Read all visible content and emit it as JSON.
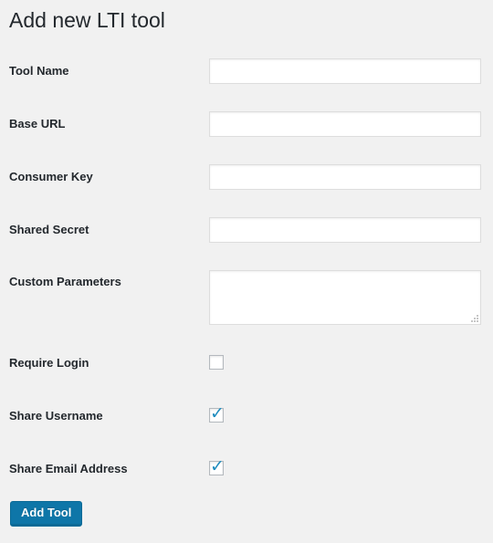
{
  "page": {
    "title": "Add new LTI tool",
    "background_color": "#f1f1f1",
    "text_color": "#23282d"
  },
  "form": {
    "fields": [
      {
        "label": "Tool Name",
        "type": "text",
        "value": "",
        "placeholder": ""
      },
      {
        "label": "Base URL",
        "type": "text",
        "value": "",
        "placeholder": ""
      },
      {
        "label": "Consumer Key",
        "type": "text",
        "value": "",
        "placeholder": ""
      },
      {
        "label": "Shared Secret",
        "type": "text",
        "value": "",
        "placeholder": ""
      },
      {
        "label": "Custom Parameters",
        "type": "textarea",
        "value": "",
        "placeholder": ""
      },
      {
        "label": "Require Login",
        "type": "checkbox",
        "checked": false
      },
      {
        "label": "Share Username",
        "type": "checkbox",
        "checked": true
      },
      {
        "label": "Share Email Address",
        "type": "checkbox",
        "checked": true
      }
    ]
  },
  "checkbox": {
    "check_glyph": "✓",
    "check_color": "#1e8cbe",
    "border_color": "#b4b9be"
  },
  "submit": {
    "label": "Add Tool",
    "background_color": "#0e76a8",
    "border_color": "#0a6a96",
    "text_color": "#ffffff"
  }
}
